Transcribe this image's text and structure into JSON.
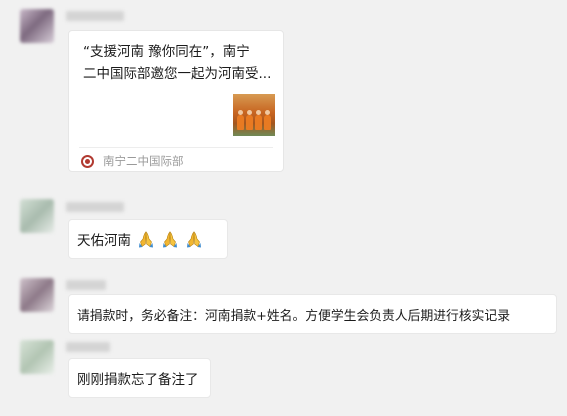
{
  "messages": [
    {
      "type": "link_card",
      "card": {
        "title": "“支援河南  豫你同在”，南宁\n二中国际部邀您一起为河南受...",
        "source_name": "南宁二中国际部"
      }
    },
    {
      "type": "text",
      "text": "天佑河南",
      "emoji": [
        "folded-hands",
        "folded-hands",
        "folded-hands"
      ]
    },
    {
      "type": "text",
      "text": "请捐款时，务必备注：河南捐款+姓名。方便学生会负责人后期进行核实记录"
    },
    {
      "type": "text",
      "text": "刚刚捐款忘了备注了"
    }
  ],
  "colors": {
    "background": "#f1f1f1",
    "bubble": "#ffffff",
    "source_logo": "#b13a31"
  }
}
